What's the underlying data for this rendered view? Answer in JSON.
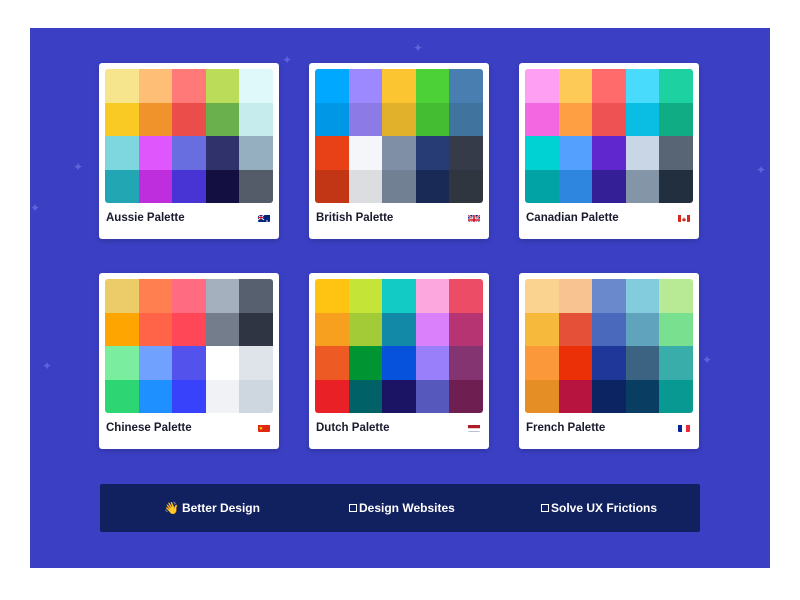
{
  "palettes": [
    {
      "name": "Aussie Palette",
      "flag": "australia-flag-icon",
      "colors": [
        [
          "#f6e58d",
          "#ffbe76",
          "#ff7979",
          "#badc58",
          "#dff9fb"
        ],
        [
          "#f9ca24",
          "#f0932b",
          "#eb4d4b",
          "#6ab04c",
          "#c7ecee"
        ],
        [
          "#7ed6df",
          "#e056fd",
          "#686de0",
          "#30336b",
          "#95afc0"
        ],
        [
          "#22a6b3",
          "#be2edd",
          "#4834d4",
          "#130f40",
          "#535c68"
        ]
      ]
    },
    {
      "name": "British Palette",
      "flag": "uk-flag-icon",
      "colors": [
        [
          "#00a8ff",
          "#9c88ff",
          "#fbc531",
          "#4cd137",
          "#487eb0"
        ],
        [
          "#0097e6",
          "#8c7ae6",
          "#e1b12c",
          "#44bd32",
          "#40739e"
        ],
        [
          "#e84118",
          "#f5f6fa",
          "#7f8fa6",
          "#273c75",
          "#353b48"
        ],
        [
          "#c23616",
          "#dcdde1",
          "#718093",
          "#192a56",
          "#2f3640"
        ]
      ]
    },
    {
      "name": "Canadian Palette",
      "flag": "canada-flag-icon",
      "colors": [
        [
          "#ff9ff3",
          "#feca57",
          "#ff6b6b",
          "#48dbfb",
          "#1dd1a1"
        ],
        [
          "#f368e0",
          "#ff9f43",
          "#ee5253",
          "#0abde3",
          "#10ac84"
        ],
        [
          "#00d2d3",
          "#54a0ff",
          "#5f27cd",
          "#c8d6e5",
          "#576574"
        ],
        [
          "#01a3a4",
          "#2e86de",
          "#341f97",
          "#8395a7",
          "#222f3e"
        ]
      ]
    },
    {
      "name": "Chinese Palette",
      "flag": "china-flag-icon",
      "colors": [
        [
          "#eccc68",
          "#ff7f50",
          "#ff6b81",
          "#a4b0be",
          "#57606f"
        ],
        [
          "#ffa502",
          "#ff6348",
          "#ff4757",
          "#747d8c",
          "#2f3542"
        ],
        [
          "#7bed9f",
          "#70a1ff",
          "#5352ed",
          "#ffffff",
          "#dfe4ea"
        ],
        [
          "#2ed573",
          "#1e90ff",
          "#3742fa",
          "#f1f2f6",
          "#ced6e0"
        ]
      ]
    },
    {
      "name": "Dutch Palette",
      "flag": "netherlands-flag-icon",
      "colors": [
        [
          "#ffc312",
          "#c4e538",
          "#12cbc4",
          "#fda7df",
          "#ed4c67"
        ],
        [
          "#f79f1f",
          "#a3cb38",
          "#1289a7",
          "#d980fa",
          "#b53471"
        ],
        [
          "#ee5a24",
          "#009432",
          "#0652dd",
          "#9980fa",
          "#833471"
        ],
        [
          "#ea2027",
          "#006266",
          "#1b1464",
          "#5758bb",
          "#6f1e51"
        ]
      ]
    },
    {
      "name": "French Palette",
      "flag": "france-flag-icon",
      "colors": [
        [
          "#fad390",
          "#f8c291",
          "#6a89cc",
          "#82ccdd",
          "#b8e994"
        ],
        [
          "#f6b93b",
          "#e55039",
          "#4a69bd",
          "#60a3bc",
          "#78e08f"
        ],
        [
          "#fa983a",
          "#eb2f06",
          "#1e3799",
          "#3c6382",
          "#38ada9"
        ],
        [
          "#e58e26",
          "#b71540",
          "#0c2461",
          "#0a3d62",
          "#079992"
        ]
      ]
    }
  ],
  "footer": {
    "item1": "Better Design",
    "item2": "Design Websites",
    "item3": "Solve UX Frictions"
  },
  "colors": {
    "background": "#3b3fc4",
    "bar": "#11205e"
  }
}
